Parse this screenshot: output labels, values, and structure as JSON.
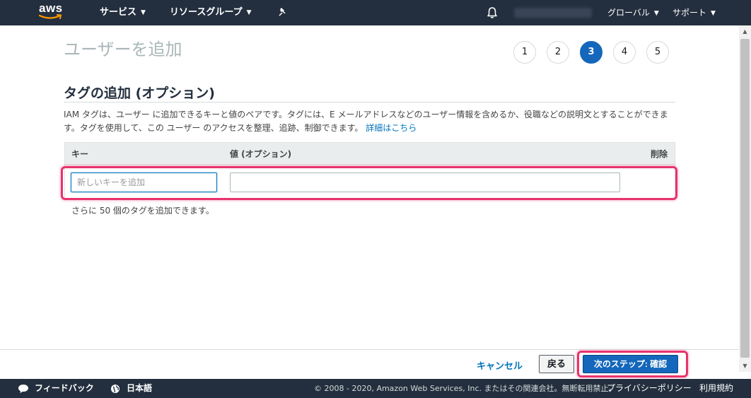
{
  "nav": {
    "logo_text": "aws",
    "services": "サービス",
    "resource_groups": "リソースグループ",
    "region": "グローバル",
    "support": "サポート",
    "icons": [
      "chevron-down-icon",
      "pin-icon",
      "bell-icon"
    ]
  },
  "page": {
    "title": "ユーザーを追加",
    "steps": [
      "1",
      "2",
      "3",
      "4",
      "5"
    ],
    "active_step": "3"
  },
  "tags_section": {
    "title": "タグの追加 (オプション)",
    "description": "IAM タグは、ユーザー に追加できるキーと値のペアです。タグには、E メールアドレスなどのユーザー情報を含めるか、役職などの説明文とすることができます。タグを使用して、この ユーザー のアクセスを整理、追跡、制御できます。",
    "details_link": "詳細はこちら",
    "columns": {
      "key": "キー",
      "value": "値 (オプション)",
      "remove": "削除"
    },
    "key_placeholder": "新しいキーを追加",
    "value_placeholder": "",
    "remaining": "さらに 50 個のタグを追加できます。"
  },
  "actions": {
    "cancel": "キャンセル",
    "back": "戻る",
    "next": "次のステップ: 確認"
  },
  "footer": {
    "feedback": "フィードバック",
    "language": "日本語",
    "copyright": "© 2008 - 2020, Amazon Web Services, Inc. またはその関連会社。無断転用禁止。",
    "privacy": "プライバシーポリシー",
    "terms": "利用規約"
  },
  "colors": {
    "nav_bg": "#232f3e",
    "primary": "#1467ba",
    "link": "#0073bb",
    "highlight": "#e8336d"
  }
}
